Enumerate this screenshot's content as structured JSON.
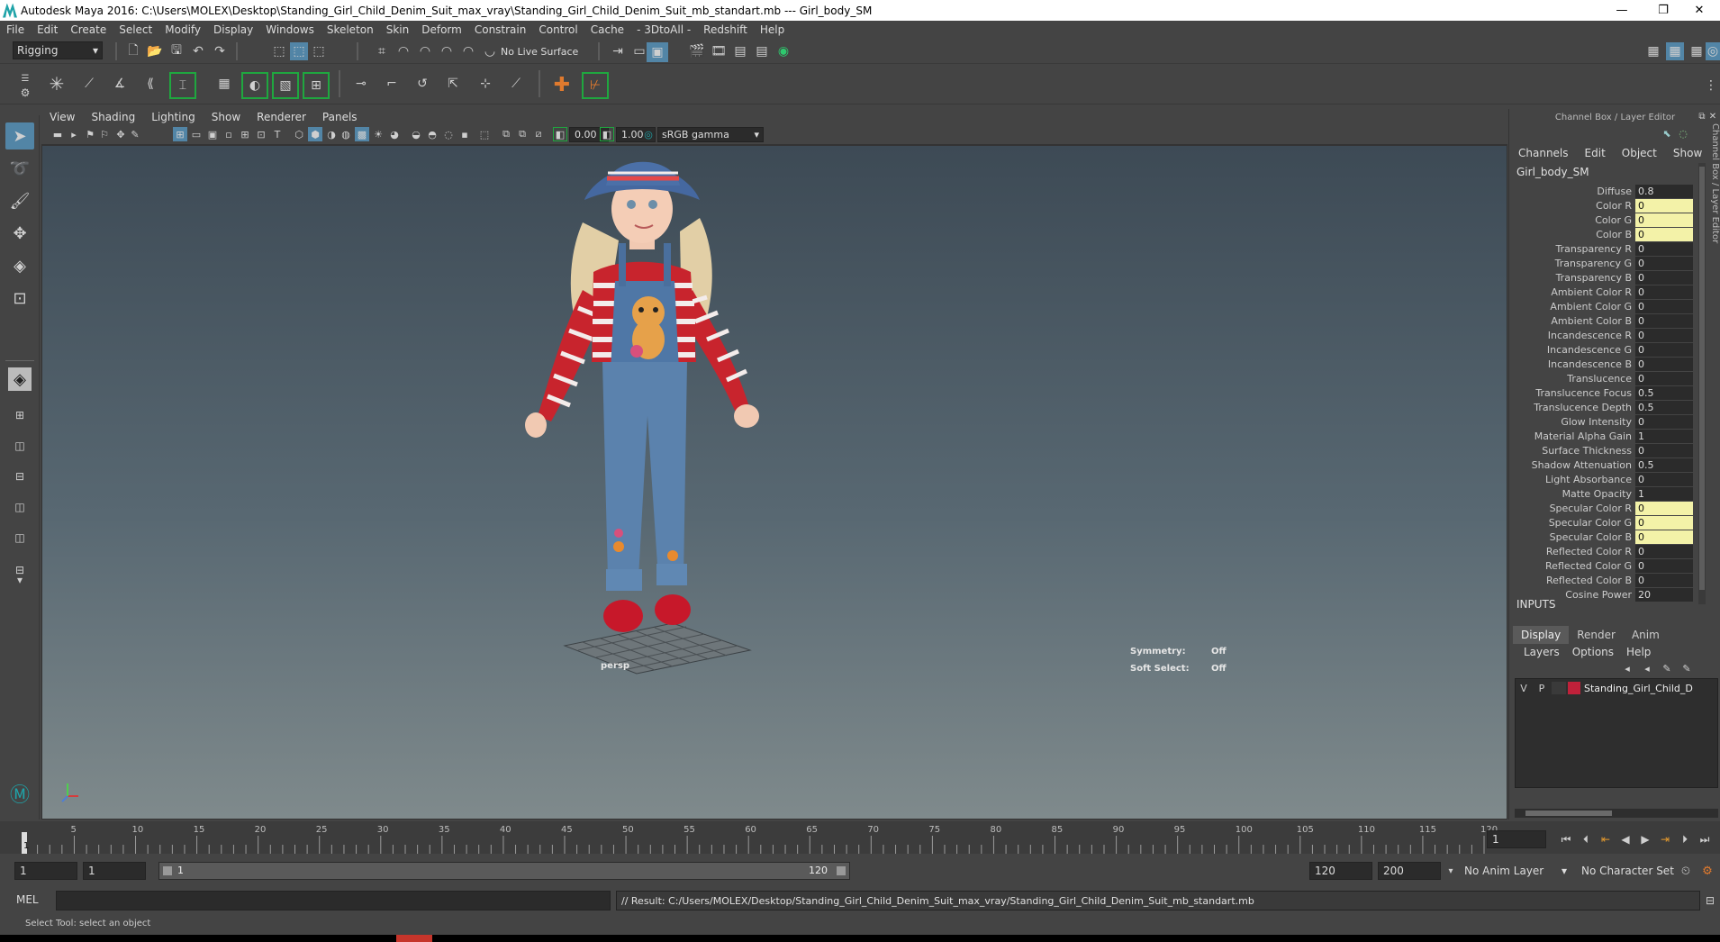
{
  "window": {
    "title": "Autodesk Maya 2016: C:\\Users\\MOLEX\\Desktop\\Standing_Girl_Child_Denim_Suit_max_vray\\Standing_Girl_Child_Denim_Suit_mb_standart.mb   ---   Girl_body_SM",
    "minimize": "—",
    "restore": "❐",
    "close": "✕"
  },
  "menubar": {
    "items": [
      "File",
      "Edit",
      "Create",
      "Select",
      "Modify",
      "Display",
      "Windows",
      "Skeleton",
      "Skin",
      "Deform",
      "Constrain",
      "Control",
      "Cache",
      "- 3DtoAll -",
      "Redshift",
      "Help"
    ]
  },
  "toolbar": {
    "mode_select": "Rigging",
    "live_surface": "No Live Surface"
  },
  "viewport": {
    "menu": [
      "View",
      "Shading",
      "Lighting",
      "Show",
      "Renderer",
      "Panels"
    ],
    "exposure": "0.00",
    "gamma": "1.00",
    "color_space": "sRGB gamma",
    "camera_label": "persp",
    "hud": {
      "symmetry_label": "Symmetry:",
      "symmetry_value": "Off",
      "soft_select_label": "Soft Select:",
      "soft_select_value": "Off"
    }
  },
  "channel_box": {
    "header": "Channel Box / Layer Editor",
    "menu": [
      "Channels",
      "Edit",
      "Object",
      "Show"
    ],
    "object_name": "Girl_body_SM",
    "attributes": [
      {
        "name": "Diffuse",
        "value": "0.8",
        "hl": false
      },
      {
        "name": "Color R",
        "value": "0",
        "hl": true
      },
      {
        "name": "Color G",
        "value": "0",
        "hl": true
      },
      {
        "name": "Color B",
        "value": "0",
        "hl": true
      },
      {
        "name": "Transparency R",
        "value": "0",
        "hl": false
      },
      {
        "name": "Transparency G",
        "value": "0",
        "hl": false
      },
      {
        "name": "Transparency B",
        "value": "0",
        "hl": false
      },
      {
        "name": "Ambient Color R",
        "value": "0",
        "hl": false
      },
      {
        "name": "Ambient Color G",
        "value": "0",
        "hl": false
      },
      {
        "name": "Ambient Color B",
        "value": "0",
        "hl": false
      },
      {
        "name": "Incandescence R",
        "value": "0",
        "hl": false
      },
      {
        "name": "Incandescence G",
        "value": "0",
        "hl": false
      },
      {
        "name": "Incandescence B",
        "value": "0",
        "hl": false
      },
      {
        "name": "Translucence",
        "value": "0",
        "hl": false
      },
      {
        "name": "Translucence Focus",
        "value": "0.5",
        "hl": false
      },
      {
        "name": "Translucence Depth",
        "value": "0.5",
        "hl": false
      },
      {
        "name": "Glow Intensity",
        "value": "0",
        "hl": false
      },
      {
        "name": "Material Alpha Gain",
        "value": "1",
        "hl": false
      },
      {
        "name": "Surface Thickness",
        "value": "0",
        "hl": false
      },
      {
        "name": "Shadow Attenuation",
        "value": "0.5",
        "hl": false
      },
      {
        "name": "Light Absorbance",
        "value": "0",
        "hl": false
      },
      {
        "name": "Matte Opacity",
        "value": "1",
        "hl": false
      },
      {
        "name": "Specular Color R",
        "value": "0",
        "hl": true
      },
      {
        "name": "Specular Color G",
        "value": "0",
        "hl": true
      },
      {
        "name": "Specular Color B",
        "value": "0",
        "hl": true
      },
      {
        "name": "Reflected Color R",
        "value": "0",
        "hl": false
      },
      {
        "name": "Reflected Color G",
        "value": "0",
        "hl": false
      },
      {
        "name": "Reflected Color B",
        "value": "0",
        "hl": false
      },
      {
        "name": "Cosine Power",
        "value": "20",
        "hl": false
      }
    ],
    "inputs_label": "INPUTS",
    "side_tab": "Channel Box / Layer Editor"
  },
  "layer_editor": {
    "tabs": [
      "Display",
      "Render",
      "Anim"
    ],
    "menu": [
      "Layers",
      "Options",
      "Help"
    ],
    "layer": {
      "v": "V",
      "p": "P",
      "color": "#c0213a",
      "name": "Standing_Girl_Child_D"
    }
  },
  "timeline": {
    "ticks": [
      "5",
      "10",
      "15",
      "20",
      "25",
      "30",
      "35",
      "40",
      "45",
      "50",
      "55",
      "60",
      "65",
      "70",
      "75",
      "80",
      "85",
      "90",
      "95",
      "100",
      "105",
      "110",
      "115",
      "120"
    ],
    "current_marker": "1",
    "current_frame": "1"
  },
  "range": {
    "start": "1",
    "playback_start": "1",
    "slider_start": "1",
    "slider_end": "120",
    "playback_end": "120",
    "end": "200",
    "anim_layer": "No Anim Layer",
    "character_set": "No Character Set"
  },
  "command": {
    "mode": "MEL",
    "result": "// Result: C:/Users/MOLEX/Desktop/Standing_Girl_Child_Denim_Suit_max_vray/Standing_Girl_Child_Denim_Suit_mb_standart.mb"
  },
  "help_line": "Select Tool: select an object",
  "colors": {
    "accent": "#5285a6",
    "highlight": "#f3f2a8",
    "background": "#444444"
  }
}
